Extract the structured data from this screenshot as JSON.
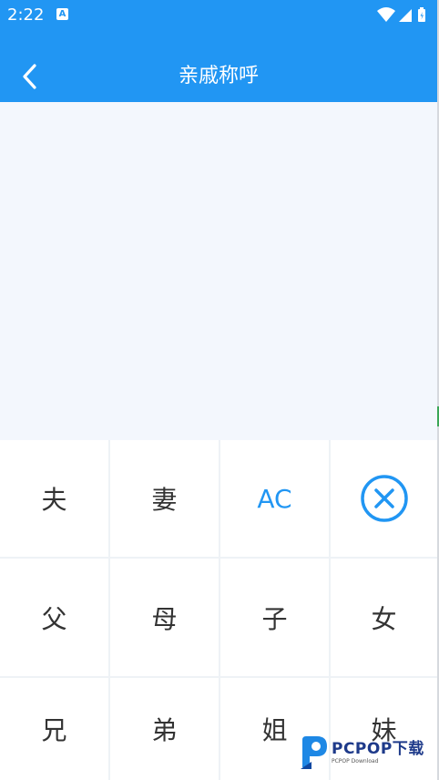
{
  "status_bar": {
    "time": "2:22",
    "notification_icon": "a-notification-icon",
    "icons": [
      "wifi-icon",
      "signal-icon",
      "battery-icon"
    ]
  },
  "app_bar": {
    "title": "亲戚称呼",
    "back_icon": "chevron-left-icon"
  },
  "display": {
    "value": ""
  },
  "keypad": {
    "rows": [
      [
        "夫",
        "妻",
        "AC",
        ""
      ],
      [
        "父",
        "母",
        "子",
        "女"
      ],
      [
        "兄",
        "弟",
        "姐",
        "妹"
      ]
    ],
    "delete_icon": "circle-x-icon"
  },
  "watermark": {
    "brand": "PCPOP下载",
    "subtitle": "PCPOP Download"
  },
  "colors": {
    "primary": "#2196f3",
    "display_bg": "#f3f7fd",
    "key_bg": "#ffffff",
    "key_text": "#333333",
    "divider": "#eef2f6"
  }
}
